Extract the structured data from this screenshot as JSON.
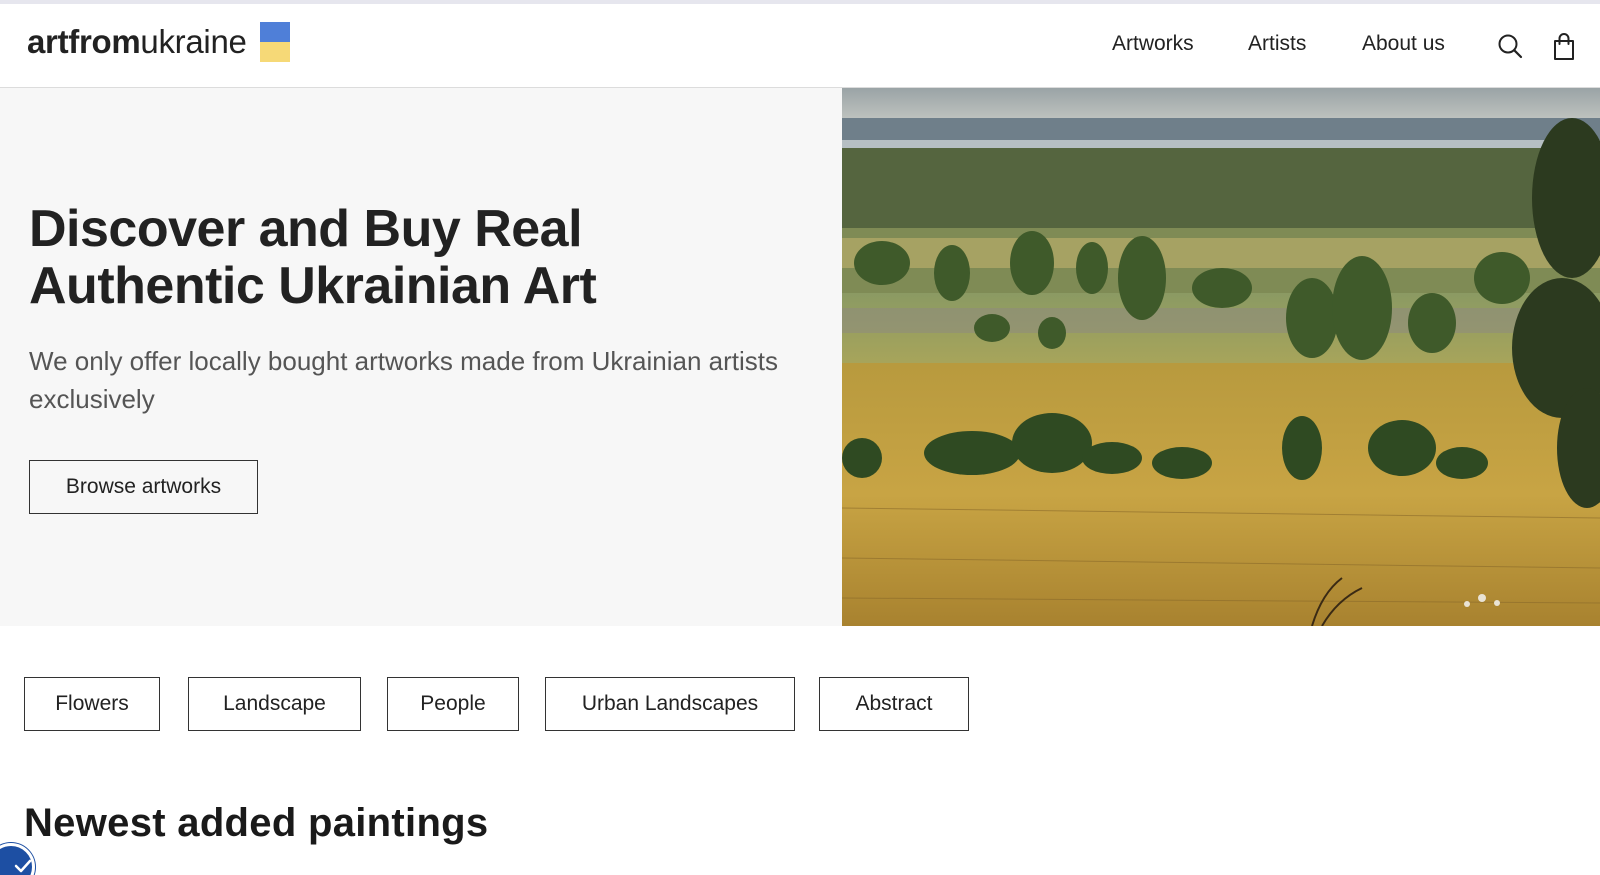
{
  "logo": {
    "bold_text": "artfrom",
    "regular_text": "ukraine",
    "flag_colors": [
      "#4f7fd8",
      "#f6d977"
    ]
  },
  "nav": {
    "items": [
      {
        "label": "Artworks"
      },
      {
        "label": "Artists"
      },
      {
        "label": "About us"
      }
    ],
    "icons": [
      "search-icon",
      "cart-icon"
    ]
  },
  "hero": {
    "title": "Discover and Buy Real Authentic Ukrainian Art",
    "subtitle": "We only offer locally bought artworks made from Ukrainian artists exclusively",
    "button_label": "Browse artworks",
    "background": "#f7f7f7"
  },
  "categories": [
    {
      "label": "Flowers"
    },
    {
      "label": "Landscape"
    },
    {
      "label": "People"
    },
    {
      "label": "Urban Landscapes"
    },
    {
      "label": "Abstract"
    }
  ],
  "newest": {
    "heading": "Newest added paintings"
  },
  "accessibility": {
    "icon": "accessibility-icon",
    "color": "#1d4fa3"
  }
}
